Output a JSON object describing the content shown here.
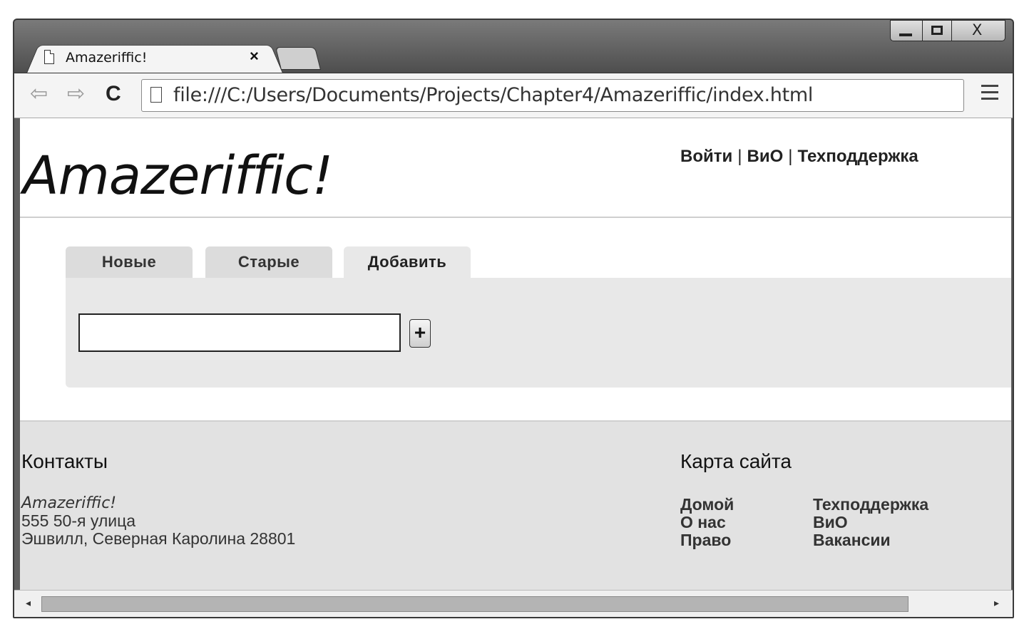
{
  "browser": {
    "tab_title": "Amazeriffic!",
    "tab_close": "×",
    "url": "file:///C:/Users/Documents/Projects/Chapter4/Amazeriffic/index.html",
    "back_glyph": "⇦",
    "forward_glyph": "⇨",
    "reload_glyph": "C",
    "close_glyph": "X"
  },
  "header": {
    "logo": "Amazeriffic!",
    "nav": [
      "Войти",
      "ВиО",
      "Техподдержка"
    ],
    "separator": "|"
  },
  "tabs": [
    {
      "label": "Новые",
      "active": false
    },
    {
      "label": "Старые",
      "active": false
    },
    {
      "label": "Добавить",
      "active": true
    }
  ],
  "add_form": {
    "input_value": "",
    "add_button": "+"
  },
  "footer": {
    "contacts_heading": "Контакты",
    "brand": "Amazeriffic!",
    "address_line1": "555 50-я улица",
    "address_line2": "Эшвилл, Северная Каролина 28801",
    "sitemap_heading": "Карта сайта",
    "sitemap_col1": [
      "Домой",
      "О нас",
      "Право"
    ],
    "sitemap_col2": [
      "Техподдержка",
      "ВиО",
      "Вакансии"
    ]
  },
  "scrollbar": {
    "left_arrow": "◂",
    "right_arrow": "▸"
  }
}
